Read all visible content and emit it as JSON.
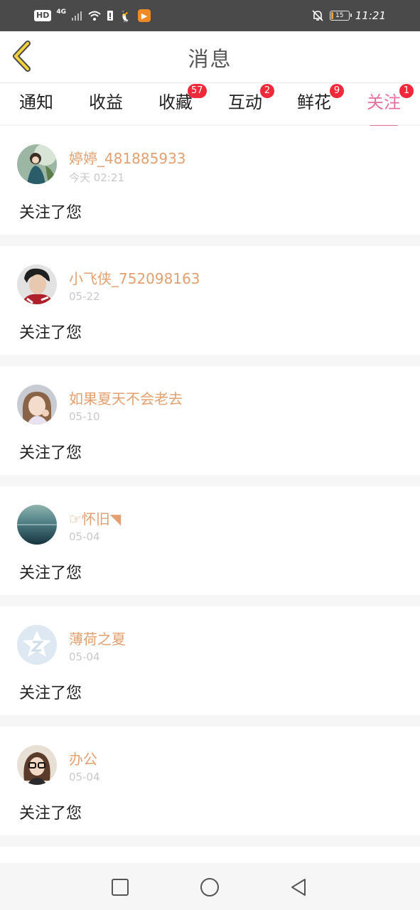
{
  "status_bar": {
    "hd": "HD",
    "network": "4G",
    "time": "11:21",
    "battery": "15",
    "battery_percent": 15
  },
  "header": {
    "title": "消息"
  },
  "tabs": [
    {
      "label": "通知",
      "badge": ""
    },
    {
      "label": "收益",
      "badge": ""
    },
    {
      "label": "收藏",
      "badge": "57"
    },
    {
      "label": "互动",
      "badge": "2"
    },
    {
      "label": "鲜花",
      "badge": "9"
    },
    {
      "label": "关注",
      "badge": "1",
      "active": true
    }
  ],
  "colors": {
    "accent": "#e76fa0",
    "username": "#e4a070",
    "badge": "#f02a3a"
  },
  "items": [
    {
      "name": "婷婷_481885933",
      "time": "今天 02:21",
      "message": "关注了您",
      "avatar": "avatar-photo-girl-green"
    },
    {
      "name": "小飞侠_752098163",
      "time": "05-22",
      "message": "关注了您",
      "avatar": "avatar-photo-boy"
    },
    {
      "name": "如果夏天不会老去",
      "time": "05-10",
      "message": "关注了您",
      "avatar": "avatar-photo-girl"
    },
    {
      "name": "☞怀旧◥",
      "time": "05-04",
      "message": "关注了您",
      "avatar": "avatar-photo-sea"
    },
    {
      "name": "薄荷之夏",
      "time": "05-04",
      "message": "关注了您",
      "avatar": "avatar-default-star"
    },
    {
      "name": "办公",
      "time": "05-04",
      "message": "关注了您",
      "avatar": "avatar-photo-glasses"
    }
  ]
}
